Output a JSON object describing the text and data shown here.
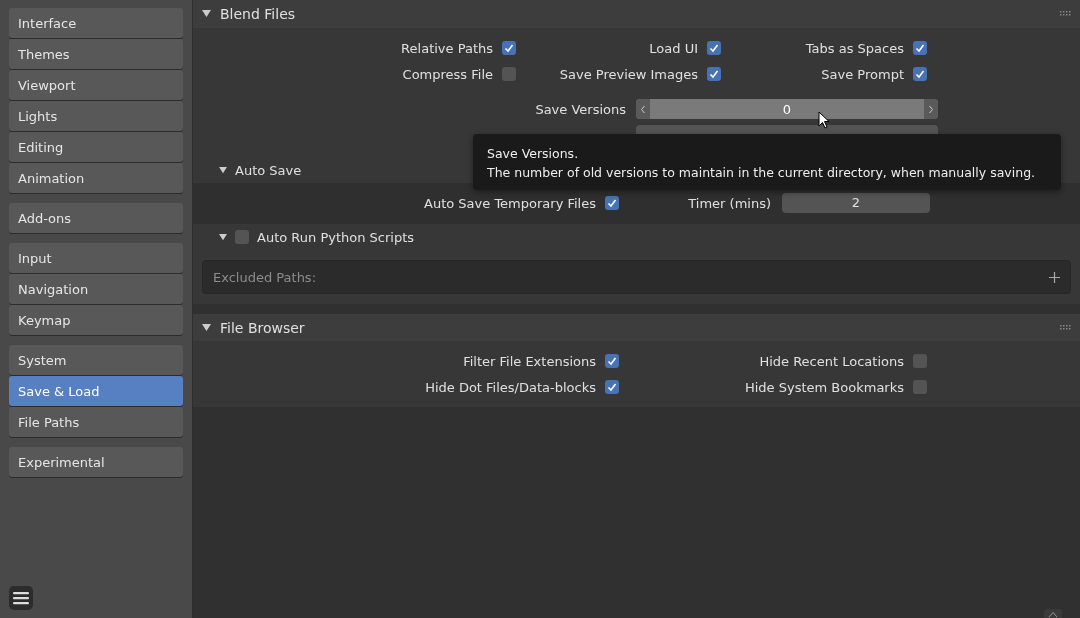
{
  "sidebar": {
    "groups": [
      [
        {
          "label": "Interface",
          "selected": false
        },
        {
          "label": "Themes",
          "selected": false
        },
        {
          "label": "Viewport",
          "selected": false
        },
        {
          "label": "Lights",
          "selected": false
        },
        {
          "label": "Editing",
          "selected": false
        },
        {
          "label": "Animation",
          "selected": false
        }
      ],
      [
        {
          "label": "Add-ons",
          "selected": false
        }
      ],
      [
        {
          "label": "Input",
          "selected": false
        },
        {
          "label": "Navigation",
          "selected": false
        },
        {
          "label": "Keymap",
          "selected": false
        }
      ],
      [
        {
          "label": "System",
          "selected": false
        },
        {
          "label": "Save & Load",
          "selected": true
        },
        {
          "label": "File Paths",
          "selected": false
        }
      ],
      [
        {
          "label": "Experimental",
          "selected": false
        }
      ]
    ]
  },
  "blend_files": {
    "title": "Blend Files",
    "expanded": true,
    "options": [
      {
        "label": "Relative Paths",
        "checked": true
      },
      {
        "label": "Load UI",
        "checked": true
      },
      {
        "label": "Tabs as Spaces",
        "checked": true
      },
      {
        "label": "Compress File",
        "checked": false
      },
      {
        "label": "Save Preview Images",
        "checked": true
      },
      {
        "label": "Save Prompt",
        "checked": true
      }
    ],
    "save_versions": {
      "label": "Save Versions",
      "value": "0"
    },
    "auto_save": {
      "title": "Auto Save",
      "expanded": true,
      "option": {
        "label": "Auto Save Temporary Files",
        "checked": true
      },
      "timer": {
        "label": "Timer (mins)",
        "value": "2"
      }
    },
    "auto_run": {
      "title": "Auto Run Python Scripts",
      "expanded": true,
      "checked": false,
      "excluded_paths": {
        "placeholder": "Excluded Paths:"
      }
    }
  },
  "tooltip": {
    "title": "Save Versions.",
    "description": "The number of old versions to maintain in the current directory, when manually saving."
  },
  "file_browser": {
    "title": "File Browser",
    "expanded": true,
    "options": [
      {
        "label": "Filter File Extensions",
        "checked": true
      },
      {
        "label": "Hide Recent Locations",
        "checked": false
      },
      {
        "label": "Hide Dot Files/Data-blocks",
        "checked": true
      },
      {
        "label": "Hide System Bookmarks",
        "checked": false
      }
    ]
  }
}
